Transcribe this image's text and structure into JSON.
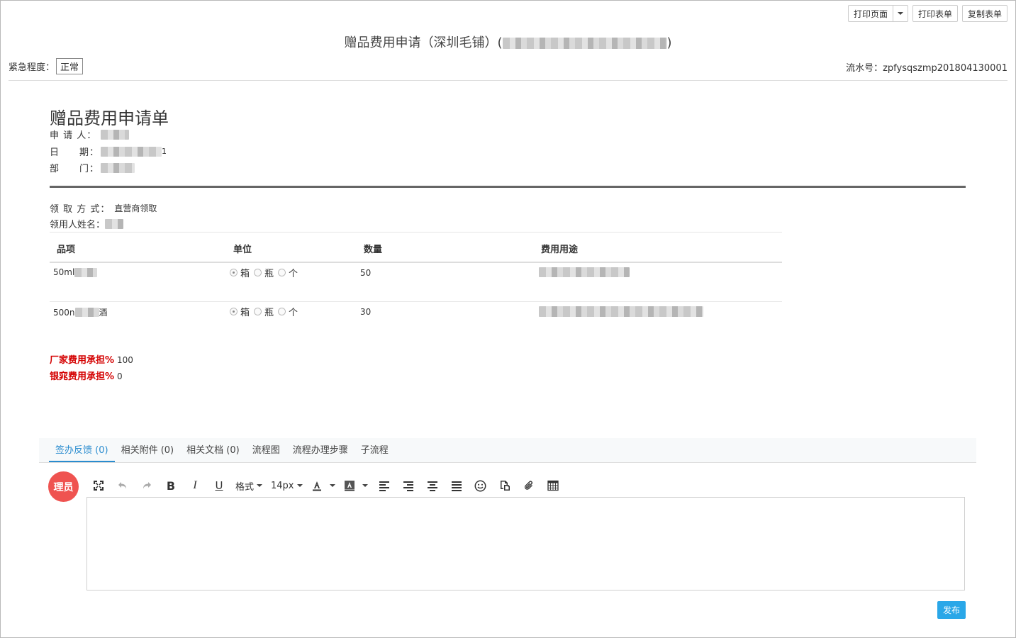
{
  "actions": {
    "print_page": "打印页面",
    "print_form": "打印表单",
    "copy_form": "复制表单"
  },
  "page_title": "赠品费用申请（深圳毛铺）(",
  "page_title_close": ")",
  "urgency": {
    "label": "紧急程度：",
    "value": "正常"
  },
  "serial": {
    "label": "流水号：",
    "value": "zpfysqszmp201804130001"
  },
  "form": {
    "title": "赠品费用申请单",
    "applicant_label": "申 请 人：",
    "date_label": "日　　期：",
    "date_suffix": "1",
    "department_label": "部　　门：",
    "pickup_method_label": "领 取 方 式：",
    "pickup_method_value": "直营商领取",
    "receiver_label": "领用人姓名："
  },
  "table": {
    "headers": {
      "item": "品项",
      "unit": "单位",
      "quantity": "数量",
      "purpose": "费用用途"
    },
    "unit_options": [
      "箱",
      "瓶",
      "个"
    ],
    "rows": [
      {
        "item_prefix": "50ml",
        "item_suffix": "",
        "quantity": "50"
      },
      {
        "item_prefix": "500n",
        "item_suffix": "酒",
        "quantity": "30"
      }
    ]
  },
  "cost": {
    "manufacturer_label": "厂家费用承担%",
    "manufacturer_value": "100",
    "silverbridge_label": "银窕费用承担%",
    "silverbridge_value": "0"
  },
  "tabs": [
    "签办反馈 (0)",
    "相关附件 (0)",
    "相关文档 (0)",
    "流程图",
    "流程办理步骤",
    "子流程"
  ],
  "avatar_text": "理员",
  "toolbar": {
    "format_label": "格式",
    "font_size": "14px"
  },
  "publish_label": "发布",
  "colors": {
    "accent": "#2a8ccf",
    "publish": "#2aa7e8",
    "avatar": "#ef5350",
    "required": "#d40000"
  }
}
